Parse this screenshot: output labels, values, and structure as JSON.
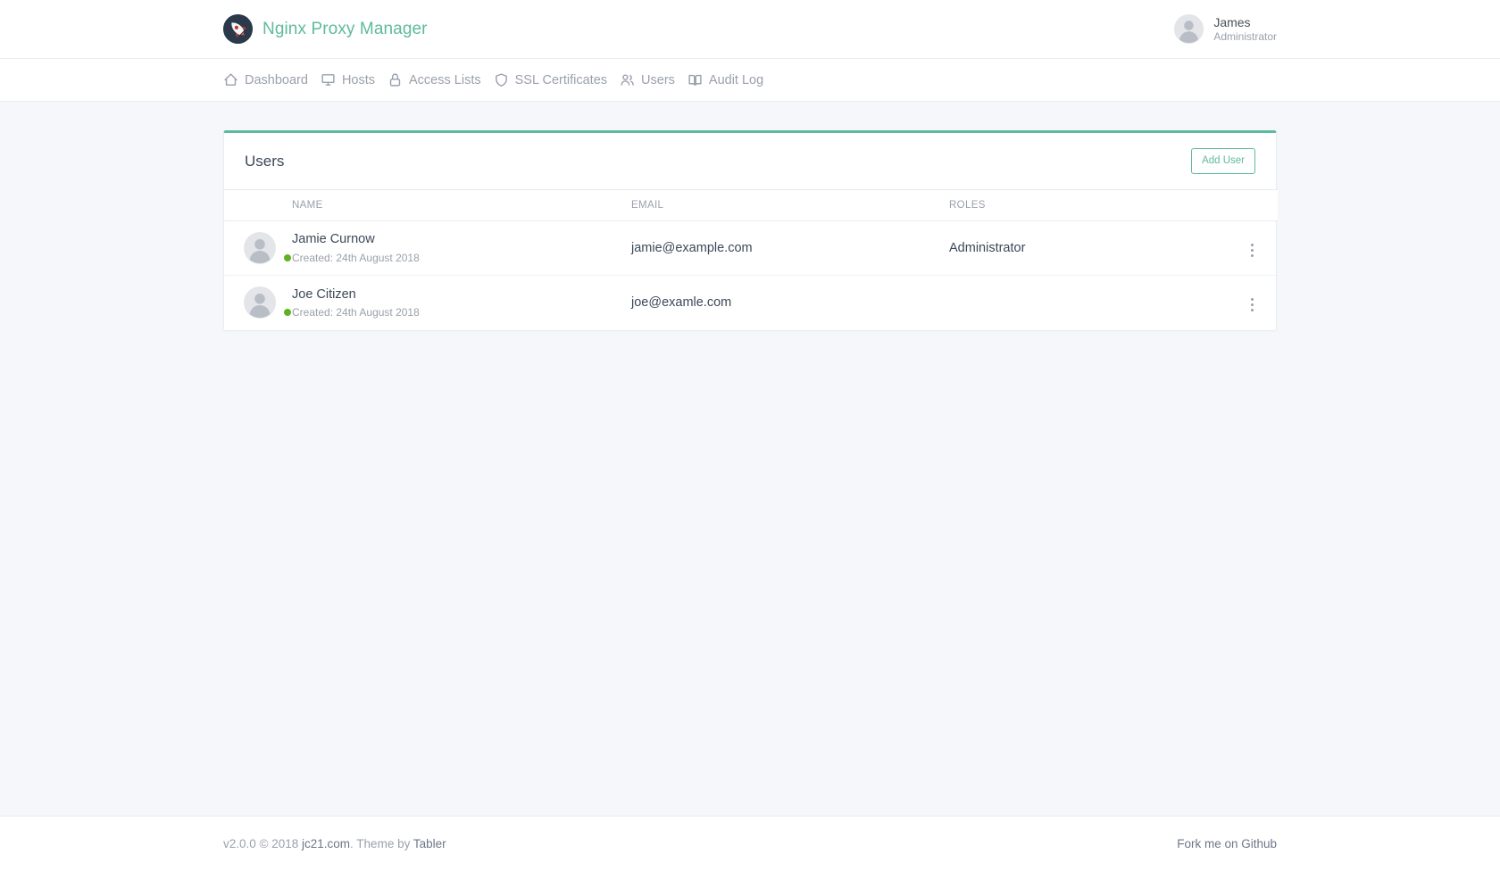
{
  "header": {
    "brand_title": "Nginx Proxy Manager",
    "brand_logo_icon": "rocket-icon",
    "account": {
      "name": "James",
      "role": "Administrator",
      "avatar_icon": "user-avatar-placeholder"
    }
  },
  "nav": {
    "items": [
      {
        "label": "Dashboard",
        "icon": "home-icon"
      },
      {
        "label": "Hosts",
        "icon": "monitor-icon"
      },
      {
        "label": "Access Lists",
        "icon": "lock-icon"
      },
      {
        "label": "SSL Certificates",
        "icon": "shield-icon"
      },
      {
        "label": "Users",
        "icon": "users-icon"
      },
      {
        "label": "Audit Log",
        "icon": "book-icon"
      }
    ]
  },
  "card": {
    "title": "Users",
    "add_user_label": "Add User",
    "accent_color": "#5eba9e"
  },
  "table": {
    "columns": [
      "NAME",
      "EMAIL",
      "ROLES"
    ],
    "rows": [
      {
        "name": "Jamie Curnow",
        "created": "Created: 24th August 2018",
        "email": "jamie@example.com",
        "roles": "Administrator",
        "status_color": "#5eb120",
        "action_icon": "kebab-menu-icon"
      },
      {
        "name": "Joe Citizen",
        "created": "Created: 24th August 2018",
        "email": "joe@examle.com",
        "roles": "",
        "status_color": "#5eb120",
        "action_icon": "kebab-menu-icon"
      }
    ]
  },
  "footer": {
    "version_text": "v2.0.0 © 2018 ",
    "site_link": "jc21.com",
    "theme_text": ". Theme by ",
    "theme_link": "Tabler",
    "github_link": "Fork me on Github"
  }
}
